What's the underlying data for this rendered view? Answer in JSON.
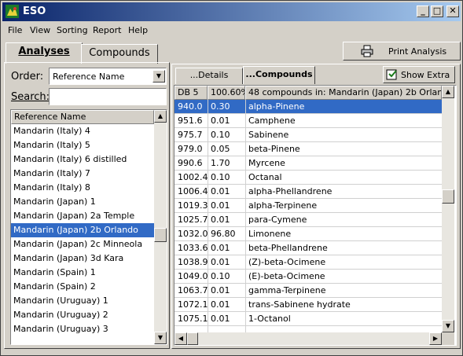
{
  "window": {
    "title": "ESO"
  },
  "caption_buttons": {
    "minimize": "_",
    "maximize": "□",
    "close": "✕"
  },
  "menu": [
    "File",
    "View",
    "Sorting",
    "Report",
    "Help"
  ],
  "left_tabs": {
    "analyses": "Analyses",
    "compounds": "Compounds"
  },
  "print_button": "Print Analysis",
  "order": {
    "label": "Order:",
    "value": "Reference Name"
  },
  "search": {
    "label": "Search:",
    "value": ""
  },
  "reference_list": {
    "header": "Reference Name",
    "items": [
      "Mandarin (Italy) 4",
      "Mandarin (Italy) 5",
      "Mandarin (Italy) 6 distilled",
      "Mandarin (Italy) 7",
      "Mandarin (Italy) 8",
      "Mandarin (Japan) 1",
      "Mandarin (Japan) 2a Temple",
      "Mandarin (Japan) 2b Orlando",
      "Mandarin (Japan) 2c Minneola",
      "Mandarin (Japan) 3d Kara",
      "Mandarin (Spain) 1",
      "Mandarin (Spain) 2",
      "Mandarin (Uruguay) 1",
      "Mandarin (Uruguay) 2",
      "Mandarin (Uruguay) 3"
    ],
    "selected_index": 7
  },
  "right_tabs": {
    "details": "...Details",
    "compounds": "...Compounds"
  },
  "show_extra_button": "Show Extra",
  "compound_table": {
    "headers": [
      "DB 5",
      "100.60%",
      "48 compounds in: Mandarin (Japan) 2b Orlando"
    ],
    "rows": [
      [
        "940.0",
        "0.30",
        "alpha-Pinene"
      ],
      [
        "951.6",
        "0.01",
        "Camphene"
      ],
      [
        "975.7",
        "0.10",
        "Sabinene"
      ],
      [
        "979.0",
        "0.05",
        "beta-Pinene"
      ],
      [
        "990.6",
        "1.70",
        "Myrcene"
      ],
      [
        "1002.4",
        "0.10",
        "Octanal"
      ],
      [
        "1006.4",
        "0.01",
        "alpha-Phellandrene"
      ],
      [
        "1019.3",
        "0.01",
        "alpha-Terpinene"
      ],
      [
        "1025.7",
        "0.01",
        "para-Cymene"
      ],
      [
        "1032.0",
        "96.80",
        "Limonene"
      ],
      [
        "1033.6",
        "0.01",
        "beta-Phellandrene"
      ],
      [
        "1038.9",
        "0.01",
        "(Z)-beta-Ocimene"
      ],
      [
        "1049.0",
        "0.10",
        "(E)-beta-Ocimene"
      ],
      [
        "1063.7",
        "0.01",
        "gamma-Terpinene"
      ],
      [
        "1072.1",
        "0.01",
        "trans-Sabinene hydrate"
      ],
      [
        "1075.1",
        "0.01",
        "1-Octanol"
      ]
    ],
    "selected_index": 0
  }
}
